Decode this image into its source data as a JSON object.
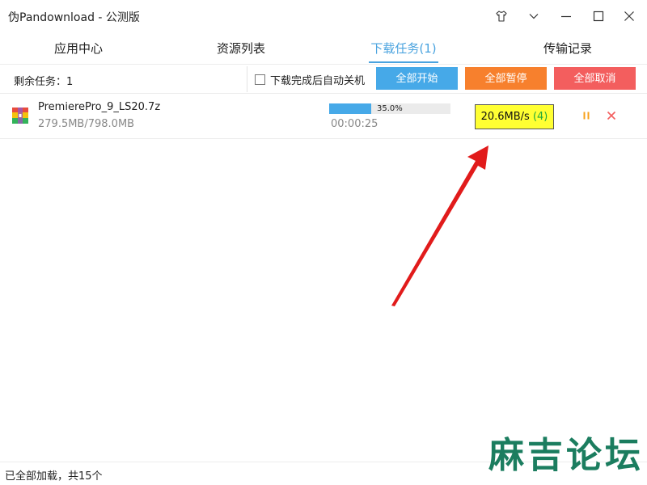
{
  "window": {
    "title": "伪Pandownload - 公测版"
  },
  "tabs": [
    {
      "label": "应用中心"
    },
    {
      "label": "资源列表"
    },
    {
      "label": "下载任务(1)"
    },
    {
      "label": "传输记录"
    }
  ],
  "toolbar": {
    "remaining": "剩余任务：1",
    "auto_shutdown_label": "下载完成后自动关机",
    "start_all": "全部开始",
    "pause_all": "全部暂停",
    "cancel_all": "全部取消"
  },
  "tasks": [
    {
      "name": "PremierePro_9_LS20.7z",
      "size": "279.5MB/798.0MB",
      "progress_text": "35.0%",
      "progress": 0.35,
      "elapsed": "00:00:25",
      "speed": "20.6MB/s",
      "threads": "(4)"
    }
  ],
  "status": {
    "text": "已全部加载，共15个"
  },
  "watermark": {
    "text": "麻吉论坛"
  },
  "colors": {
    "accent": "#4aa3df",
    "start": "#46a9e8",
    "pause": "#f7802d",
    "cancel": "#f35e5e",
    "highlight": "#ffff33",
    "arrow": "#e11b1b"
  }
}
